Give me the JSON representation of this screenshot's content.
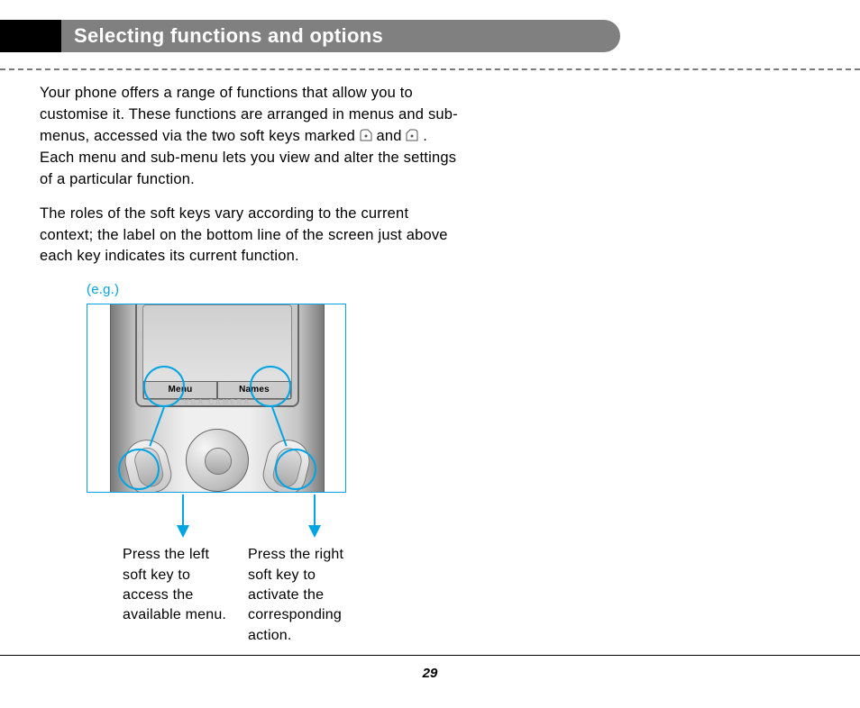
{
  "header": {
    "title": "Selecting functions and options"
  },
  "paragraphs": {
    "p1a": "Your phone offers a range of functions that allow you to customise it. These functions are arranged in menus and sub-menus, accessed via the two soft keys marked ",
    "p1b": " and ",
    "p1c": " . Each menu and sub-menu lets you view and alter the settings of a particular function.",
    "p2": "The roles of the soft keys vary according to the current context; the label on the bottom line of the screen just above each key indicates its current function."
  },
  "example_label": "(e.g.)",
  "phone": {
    "left_softkey_label": "Menu",
    "right_softkey_label": "Names",
    "below_screen_text": "VGA  CAMERA"
  },
  "captions": {
    "left": "Press the left soft key to access the available menu.",
    "right": "Press the right soft key to activate the corresponding action."
  },
  "page_number": "29",
  "colors": {
    "accent": "#00A4E4"
  }
}
